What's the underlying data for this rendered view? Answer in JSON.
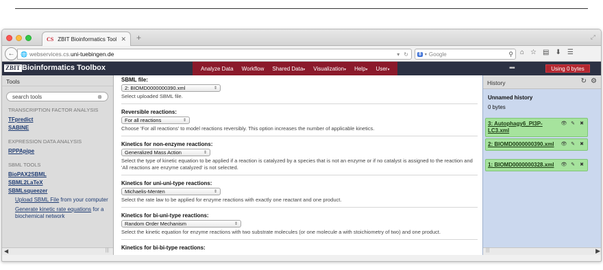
{
  "browser": {
    "tab_title": "ZBIT Bioinformatics Toolbox",
    "tab_logo": "CS",
    "url_prefix": "webservices.cs.",
    "url_domain": "uni-tuebingen.de",
    "search_placeholder": "Google",
    "search_engine_label": "8"
  },
  "masthead": {
    "logo": "ZBIT",
    "brand": "Bioinformatics Toolbox",
    "menu": [
      "Analyze Data",
      "Workflow",
      "Shared Data",
      "Visualization",
      "Help",
      "User"
    ],
    "usage": "Using 0 bytes",
    "accent_color": "#8b1a2b"
  },
  "tools": {
    "title": "Tools",
    "search_placeholder": "search tools",
    "sections": [
      {
        "heading": "TRANSCRIPTION FACTOR ANALYSIS",
        "links": [
          "TFpredict",
          "SABINE"
        ]
      },
      {
        "heading": "EXPRESSION DATA ANALYSIS",
        "links": [
          "RPPApipe"
        ]
      },
      {
        "heading": "SBML TOOLS",
        "links": [
          "BioPAX2SBML",
          "SBML2LaTeX",
          "SBMLsqueezer"
        ]
      }
    ],
    "sub_links": [
      {
        "link": "Upload SBML File",
        "rest": " from your computer"
      },
      {
        "link": "Generate kinetic rate equations",
        "rest": " for a biochemical network"
      }
    ]
  },
  "form": {
    "fields": [
      {
        "label": "SBML file:",
        "value": "2: BIOMD0000000390.xml",
        "help": "Select uploaded SBML file."
      },
      {
        "label": "Reversible reactions:",
        "value": "For all reactions",
        "help": "Choose 'For all reactions' to model reactions reversibly. This option increases the number of applicable kinetics."
      },
      {
        "label": "Kinetics for non-enzyme reactions:",
        "value": "Generalized Mass Action",
        "help": "Select the type of kinetic equation to be applied if a reaction is catalyzed by a species that is not an enzyme or if no catalyst is assigned to the reaction and 'All reactions are enzyme catalyzed' is not selected."
      },
      {
        "label": "Kinetics for uni-uni-type reactions:",
        "value": "Michaelis-Menten",
        "help": "Select the rate law to be applied for enzyme reactions with exactly one reactant and one product."
      },
      {
        "label": "Kinetics for bi-uni-type reactions:",
        "value": "Random Order Mechanism",
        "help": "Select the kinetic equation for enzyme reactions with two substrate molecules (or one molecule a with stoichiometry of two) and one product."
      },
      {
        "label": "Kinetics for bi-bi-type reactions:",
        "value": "",
        "help": ""
      }
    ]
  },
  "history": {
    "title": "History",
    "name": "Unnamed history",
    "size": "0 bytes",
    "datasets": [
      {
        "title": "3: Autophagy6_PI3P-LC3.xml"
      },
      {
        "title": "2: BIOMD0000000390.xml"
      },
      {
        "title": "1: BIOMD0000000328.xml"
      }
    ],
    "dataset_color": "#a6e39d"
  }
}
